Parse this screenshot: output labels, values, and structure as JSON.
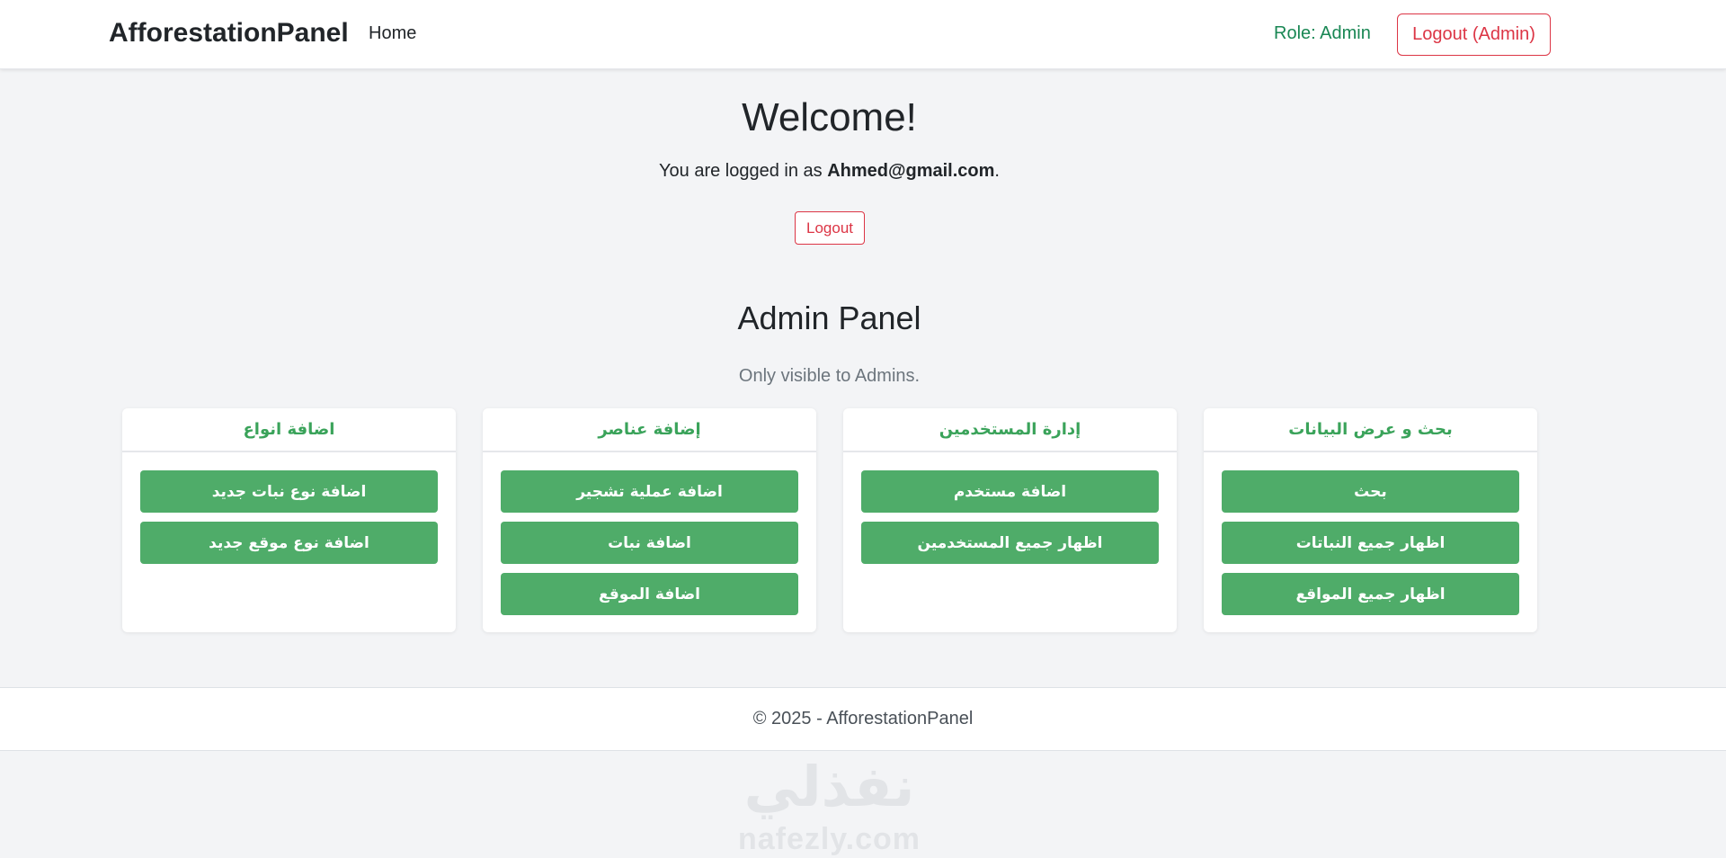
{
  "navbar": {
    "brand": "AfforestationPanel",
    "home_label": "Home",
    "role_label": "Role: Admin",
    "logout_label": "Logout (Admin)"
  },
  "welcome": {
    "title": "Welcome!",
    "logged_prefix": "You are logged in as ",
    "email": "Ahmed@gmail.com",
    "logged_suffix": ".",
    "logout_label": "Logout"
  },
  "admin_panel": {
    "title": "Admin Panel",
    "subtitle": "Only visible to Admins."
  },
  "cards": [
    {
      "header": "اضافة انواع",
      "buttons": [
        "اضافة نوع نبات جديد",
        "اضافة نوع موقع جديد"
      ]
    },
    {
      "header": "إضافة عناصر",
      "buttons": [
        "اضافة عملية تشجير",
        "اضافة نبات",
        "اضافة الموقع"
      ]
    },
    {
      "header": "إدارة المستخدمين",
      "buttons": [
        "اضافة مستخدم",
        "اظهار جميع المستخدمين"
      ]
    },
    {
      "header": "بحث و عرض البيانات",
      "buttons": [
        "بحث",
        "اظهار جميع النباتات",
        "اظهار جميع المواقع"
      ]
    }
  ],
  "footer": {
    "text": "© 2025 - AfforestationPanel"
  },
  "watermark": {
    "arabic": "نفذلي",
    "latin": "nafezly.com"
  },
  "colors": {
    "accent_green": "#4fac69",
    "header_green": "#3aa35a",
    "role_green": "#198754",
    "danger_red": "#dc3545"
  }
}
